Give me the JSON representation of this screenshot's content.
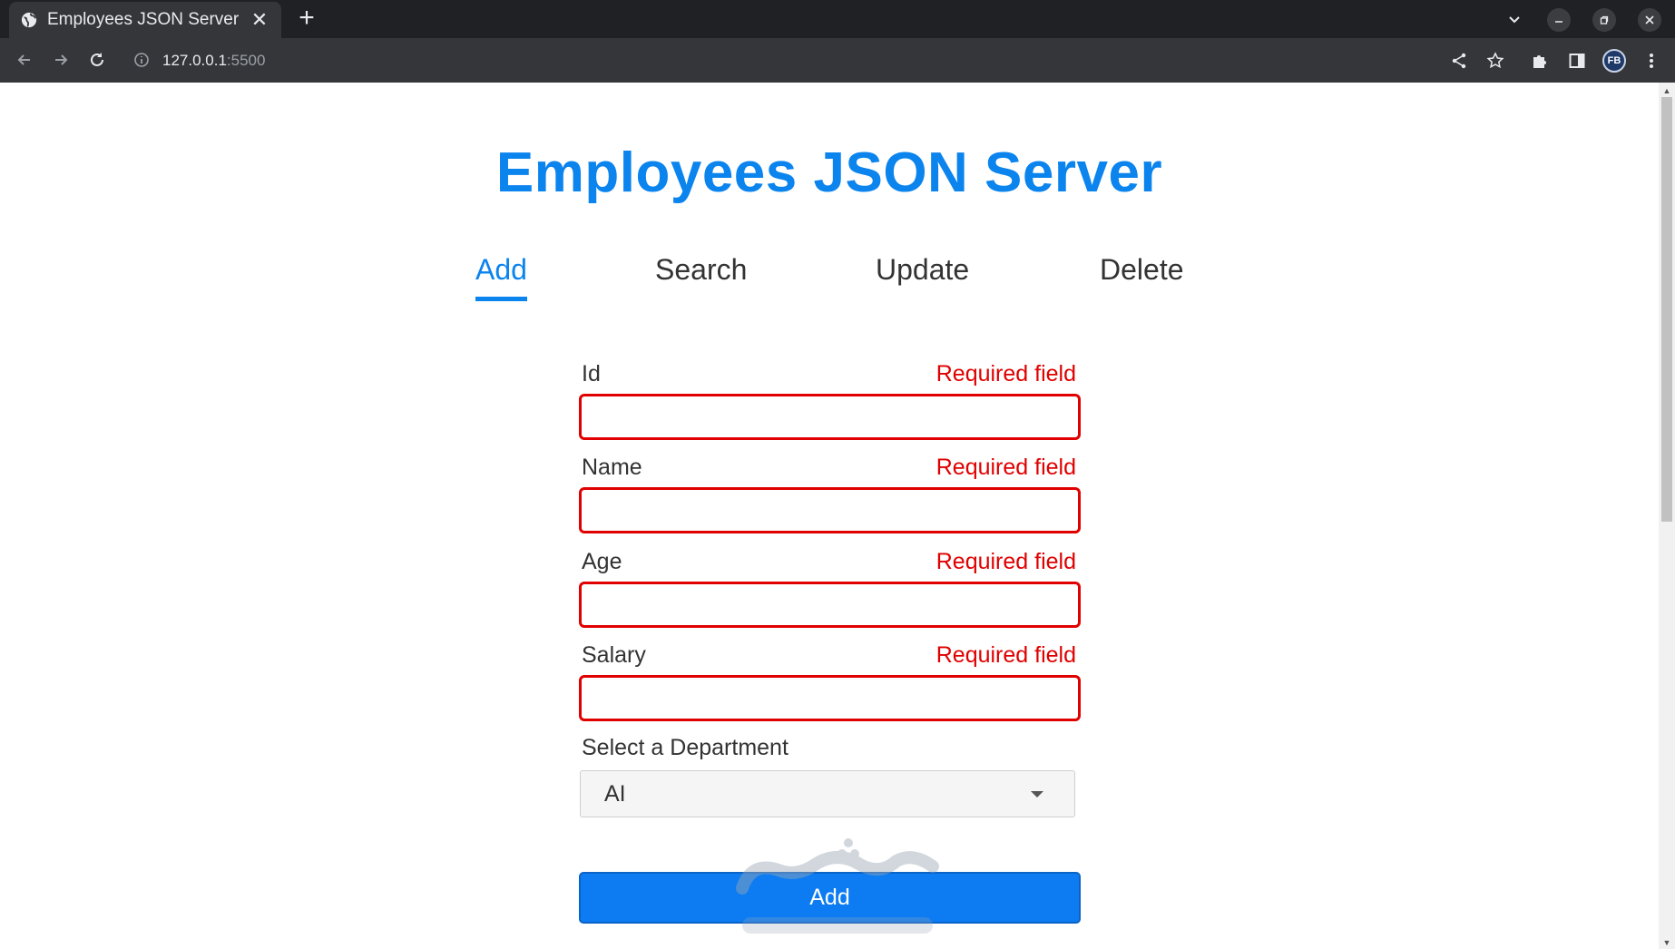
{
  "browser": {
    "tab_title": "Employees JSON Server",
    "tab_close": "✕",
    "new_tab": "+",
    "url_host": "127.0.0.1",
    "url_port": ":5500",
    "profile_initials": "FB"
  },
  "page": {
    "title": "Employees JSON Server",
    "nav": [
      {
        "label": "Add",
        "active": true
      },
      {
        "label": "Search",
        "active": false
      },
      {
        "label": "Update",
        "active": false
      },
      {
        "label": "Delete",
        "active": false
      }
    ],
    "form": {
      "fields": [
        {
          "label": "Id",
          "error": "Required field",
          "value": ""
        },
        {
          "label": "Name",
          "error": "Required field",
          "value": ""
        },
        {
          "label": "Age",
          "error": "Required field",
          "value": ""
        },
        {
          "label": "Salary",
          "error": "Required field",
          "value": ""
        }
      ],
      "department_label": "Select a Department",
      "department_value": "AI",
      "submit_label": "Add"
    }
  },
  "colors": {
    "accent": "#0b84ee",
    "error": "#e00000",
    "button": "#0d7cf2"
  }
}
